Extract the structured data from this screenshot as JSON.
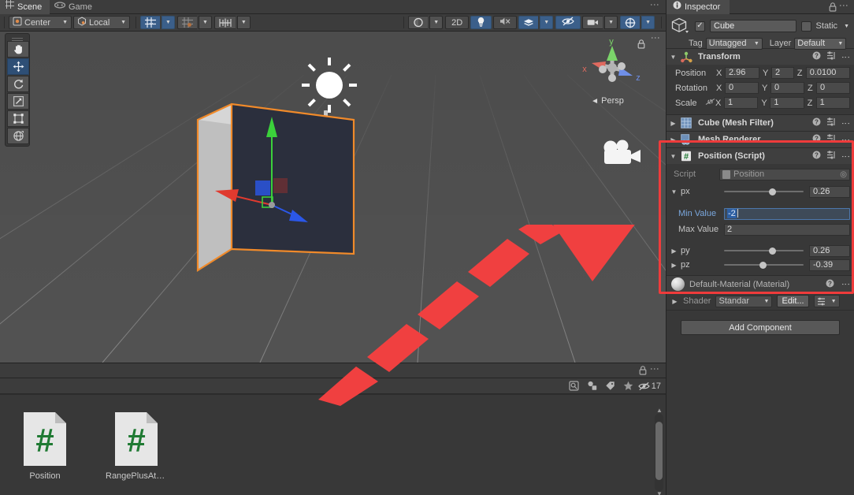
{
  "scene_panel": {
    "tabs": [
      {
        "label": "Scene",
        "icon": "grid-icon",
        "active": true
      },
      {
        "label": "Game",
        "icon": "gamepad-icon",
        "active": false
      }
    ],
    "toolbar": {
      "pivot_mode": "Center",
      "handle_space": "Local",
      "grid_snap_icon": "grid-snapping-icon",
      "snap_increment_icon": "snap-increment-icon",
      "grid_visibility_icon": "grid-visibility-icon",
      "draw_mode_icon": "shaded-mode-icon",
      "two_d_label": "2D",
      "lighting_icon": "light-bulb-icon",
      "audio_icon": "audio-mute-icon",
      "fx_icon": "effects-icon",
      "hidden_objects_icon": "scene-visibility-icon",
      "camera_icon": "camera-settings-icon",
      "gizmos_icon": "gizmos-icon"
    },
    "tools": [
      {
        "name": "hand-tool",
        "glyph": "✋",
        "active": false
      },
      {
        "name": "move-tool",
        "glyph": "move",
        "active": true
      },
      {
        "name": "rotate-tool",
        "glyph": "rotate",
        "active": false
      },
      {
        "name": "scale-tool",
        "glyph": "scale",
        "active": false
      },
      {
        "name": "rect-tool",
        "glyph": "rect",
        "active": false
      },
      {
        "name": "transform-tool",
        "glyph": "transform",
        "active": false
      }
    ],
    "gizmo": {
      "x_label": "x",
      "y_label": "y",
      "z_label": "z",
      "projection": "Persp",
      "lock_icon": "lock-icon"
    },
    "objects": {
      "selected_object": "Cube",
      "light_icon": "directional-light-gizmo",
      "camera_icon": "camera-gizmo"
    }
  },
  "project_panel": {
    "lock_icon": "lock-icon",
    "menu_icon": "kebab-menu-icon",
    "toolbar_icons": [
      "save-search-icon",
      "filter-by-type-icon",
      "filter-by-label-icon",
      "favorites-icon"
    ],
    "hidden_count": "17",
    "assets": [
      {
        "name": "Position",
        "type": "csharp-script"
      },
      {
        "name": "RangePlusAttribu...",
        "type": "csharp-script"
      }
    ]
  },
  "inspector": {
    "tab_label": "Inspector",
    "tab_icon": "info-icon",
    "lock_icon": "lock-icon",
    "menu_icon": "kebab-menu-icon",
    "object": {
      "icon": "cube-icon",
      "enabled": true,
      "name": "Cube",
      "static_label": "Static",
      "static_checked": false,
      "tag_label": "Tag",
      "tag_value": "Untagged",
      "layer_label": "Layer",
      "layer_value": "Default"
    },
    "components": [
      {
        "title": "Transform",
        "icon": "transform-icon",
        "expanded": true,
        "rows": [
          {
            "label": "Position",
            "x": "2.96",
            "y": "2",
            "z": "0.0100"
          },
          {
            "label": "Rotation",
            "x": "0",
            "y": "0",
            "z": "0"
          },
          {
            "label": "Scale",
            "x": "1",
            "y": "1",
            "z": "1",
            "link": true
          }
        ],
        "axis_labels": {
          "x": "X",
          "y": "Y",
          "z": "Z"
        }
      },
      {
        "title": "Cube (Mesh Filter)",
        "icon": "mesh-filter-icon",
        "expanded": false
      },
      {
        "title": "Mesh Renderer",
        "icon": "mesh-renderer-icon",
        "expanded": false
      },
      {
        "title": "Position (Script)",
        "icon": "script-icon",
        "expanded": true,
        "script_label": "Script",
        "script_value": "Position",
        "sliders": [
          {
            "name": "px",
            "value": "0.26",
            "knob_pct": 56,
            "expanded": true
          },
          {
            "name": "py",
            "value": "0.26",
            "knob_pct": 56,
            "expanded": false
          },
          {
            "name": "pz",
            "value": "-0.39",
            "knob_pct": 47,
            "expanded": false
          }
        ],
        "attributes": [
          {
            "label": "Min Value",
            "value": "-2",
            "focused": true
          },
          {
            "label": "Max Value",
            "value": "2",
            "focused": false
          }
        ]
      }
    ],
    "material": {
      "title": "Default-Material (Material)",
      "shader_label": "Shader",
      "shader_value": "Standar",
      "edit_label": "Edit...",
      "preset_icon": "preset-list-icon"
    },
    "add_component_label": "Add Component"
  },
  "annotation": {
    "highlight_color": "#ef3b3b",
    "arrow_color": "#f04040"
  }
}
